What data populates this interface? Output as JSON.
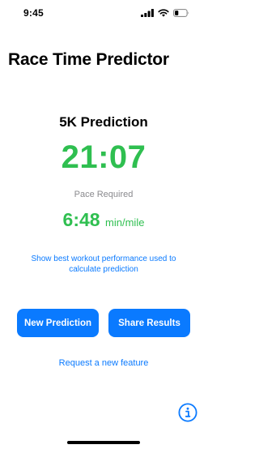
{
  "status_bar": {
    "time": "9:45",
    "icons": [
      "cellular-signal-icon",
      "wifi-icon",
      "battery-icon"
    ]
  },
  "app": {
    "title": "Race Time Predictor"
  },
  "prediction": {
    "heading": "5K Prediction",
    "time": "21:07",
    "pace_label": "Pace Required",
    "pace_value": "6:48",
    "pace_unit": "min/mile",
    "details_link": "Show best workout performance used to calculate prediction"
  },
  "actions": {
    "new_prediction": "New Prediction",
    "share_results": "Share Results",
    "request_feature": "Request a new feature"
  },
  "icons": {
    "info": "info-icon"
  },
  "colors": {
    "accent": "#0a7aff",
    "highlight_green": "#2fbf50",
    "secondary_text": "#8a8a8e"
  }
}
